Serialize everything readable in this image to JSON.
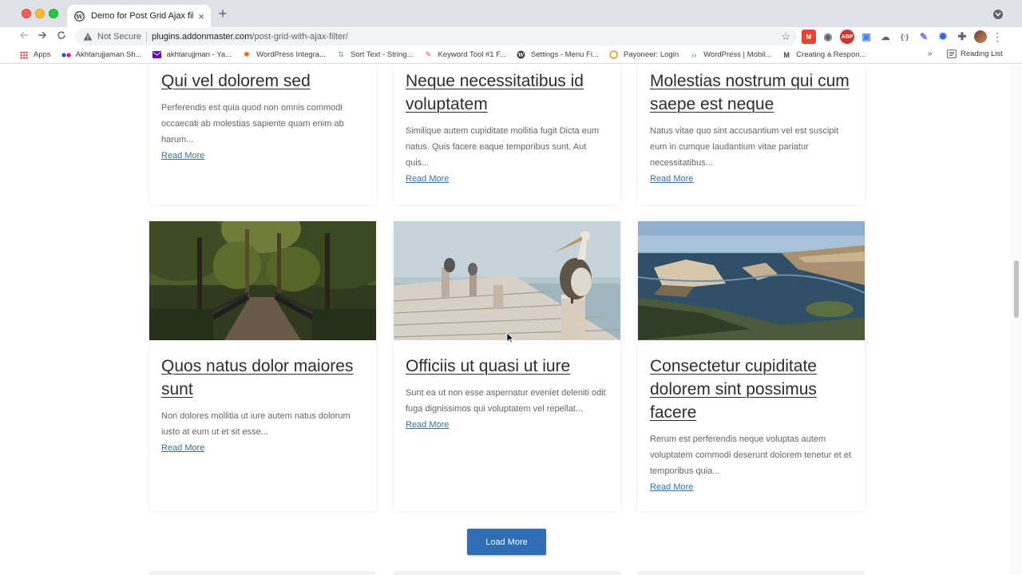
{
  "browser": {
    "tab_title": "Demo for Post Grid Ajax filter",
    "new_tab_symbol": "+",
    "close_symbol": "×",
    "security_label": "Not Secure",
    "url_host": "plugins.addonmaster.com",
    "url_path": "/post-grid-with-ajax-filter/",
    "gmail_badge": "M",
    "abp_label": "ABP",
    "code_label": "{·}",
    "bookmarks": [
      {
        "label": "Apps",
        "icon": "apps-grid-icon"
      },
      {
        "label": "Akhtarujjaman Sh...",
        "icon": "flickr-icon"
      },
      {
        "label": "akhtarujjman - Ya...",
        "icon": "yahoo-mail-icon"
      },
      {
        "label": "WordPress Integra...",
        "icon": "zapier-icon"
      },
      {
        "label": "Sort Text - String...",
        "icon": "sort-icon"
      },
      {
        "label": "Keyword Tool #1 F...",
        "icon": "keyword-tool-icon"
      },
      {
        "label": "Settings - Menu Fi...",
        "icon": "wordpress-icon"
      },
      {
        "label": "Payoneer: Login",
        "icon": "payoneer-icon"
      },
      {
        "label": "WordPress | Mobil...",
        "icon": "code-icon"
      },
      {
        "label": "Creating a Respon...",
        "icon": "medium-icon"
      }
    ],
    "more_symbol": "»",
    "reading_list_label": "Reading List"
  },
  "posts": [
    {
      "title": "Qui vel dolorem sed",
      "excerpt": "Perferendis est quia quod non omnis commodi occaecati ab molestias sapiente quam enim ab harum...",
      "read_more": "Read More"
    },
    {
      "title": "Neque necessitatibus id voluptatem",
      "excerpt": "Similique autem cupiditate mollitia fugit Dicta eum natus. Quis facere eaque temporibus sunt. Aut quis...",
      "read_more": "Read More"
    },
    {
      "title": "Molestias nostrum qui cum saepe est neque",
      "excerpt": "Natus vitae quo sint accusantium vel est suscipit eum in cumque laudantium vitae pariatur necessitatibus...",
      "read_more": "Read More"
    },
    {
      "title": "Quos natus dolor maiores sunt",
      "excerpt": "Non dolores mollitia ut iure autem natus dolorum iusto at eum ut et sit esse...",
      "read_more": "Read More",
      "image": "forest-bridge"
    },
    {
      "title": "Officiis ut quasi ut iure",
      "excerpt": "Sunt ea ut non esse aspernatur eveniet deleniti odit fuga dignissimos qui voluptatem vel repellat...",
      "read_more": "Read More",
      "image": "pelican-pier"
    },
    {
      "title": "Consectetur cupiditate dolorem sint possimus facere",
      "excerpt": "Rerum est perferendis neque voluptas autem voluptatem commodi deserunt dolorem tenetur et et temporibus quia...",
      "read_more": "Read More",
      "image": "coastal-cliffs"
    }
  ],
  "load_more_label": "Load More",
  "colors": {
    "button": "#2f6db5",
    "link": "#3a6ea5",
    "title": "#2d2d2d"
  }
}
